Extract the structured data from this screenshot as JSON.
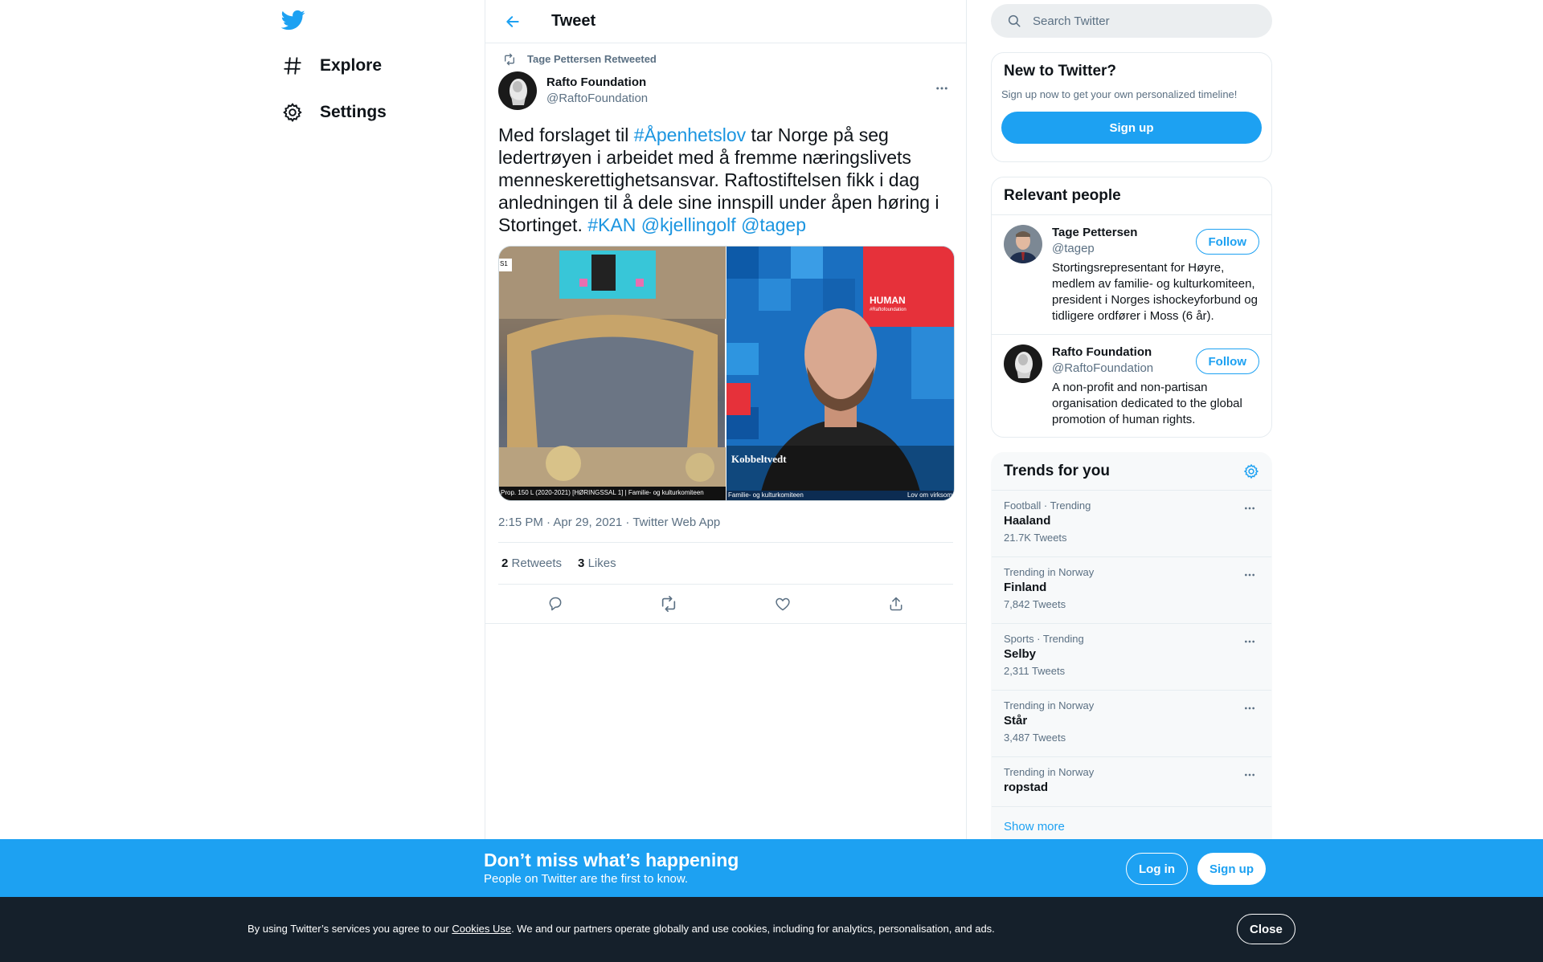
{
  "colors": {
    "brand": "#1da1f2",
    "link": "#1b95e0",
    "text": "#0f1419",
    "muted": "#5b7083"
  },
  "nav": {
    "logo_icon": "twitter-bird-icon",
    "items": [
      {
        "label": "Explore",
        "icon": "hashtag-icon"
      },
      {
        "label": "Settings",
        "icon": "gear-icon"
      }
    ]
  },
  "header": {
    "title": "Tweet",
    "back_icon": "arrow-left-icon"
  },
  "tweet": {
    "retweeted_by": "Tage Pettersen Retweeted",
    "author_name": "Rafto Foundation",
    "author_handle": "@RaftoFoundation",
    "text_parts": {
      "p1": "Med forslaget til ",
      "h1": "#Åpenhetslov",
      "p2": " tar Norge på seg ledertrøyen i arbeidet med å fremme næringslivets menneskerettighetsansvar. Raftostiftelsen fikk i dag anledningen til å dele sine innspill under åpen høring i Stortinget. ",
      "h2": "#KAN",
      "p3": " ",
      "m1": "@kjellingolf",
      "p4": " ",
      "m2": "@tagep"
    },
    "media": {
      "left_caption": "Prop. 150 L (2020-2021) [HØRINGSSAL 1] | Familie- og kulturkomiteen",
      "left_corner": "S1",
      "right_sign": "HUMAN",
      "right_sign_sub": "#Raftofoundation",
      "right_name": "Kobbeltvedt",
      "right_caption_left": "Familie- og kulturkomiteen",
      "right_caption_right": "Lov om virksom"
    },
    "meta": "2:15 PM · Apr 29, 2021 · Twitter Web App",
    "retweets_count": "2",
    "retweets_label": "Retweets",
    "likes_count": "3",
    "likes_label": "Likes"
  },
  "search": {
    "placeholder": "Search Twitter"
  },
  "new_card": {
    "title": "New to Twitter?",
    "desc": "Sign up now to get your own personalized timeline!",
    "signup": "Sign up"
  },
  "people": {
    "title": "Relevant people",
    "items": [
      {
        "name": "Tage Pettersen",
        "handle": "@tagep",
        "follow": "Follow",
        "bio": "Stortingsrepresentant for Høyre, medlem av familie- og kulturkomiteen, president i Norges ishockeyforbund og tidligere ordfører i Moss (6 år)."
      },
      {
        "name": "Rafto Foundation",
        "handle": "@RaftoFoundation",
        "follow": "Follow",
        "bio": "A non-profit and non-partisan organisation dedicated to the global promotion of human rights."
      }
    ]
  },
  "trends": {
    "title": "Trends for you",
    "items": [
      {
        "context": "Football · Trending",
        "name": "Haaland",
        "count": "21.7K Tweets"
      },
      {
        "context": "Trending in Norway",
        "name": "Finland",
        "count": "7,842 Tweets"
      },
      {
        "context": "Sports · Trending",
        "name": "Selby",
        "count": "2,311 Tweets"
      },
      {
        "context": "Trending in Norway",
        "name": "Står",
        "count": "3,487 Tweets"
      },
      {
        "context": "Trending in Norway",
        "name": "ropstad",
        "count": ""
      }
    ],
    "show_more": "Show more"
  },
  "banner": {
    "title": "Don’t miss what’s happening",
    "subtitle": "People on Twitter are the first to know.",
    "login": "Log in",
    "signup": "Sign up"
  },
  "cookie": {
    "prefix": "By using Twitter’s services you agree to our ",
    "link": "Cookies Use",
    "suffix": ". We and our partners operate globally and use cookies, including for analytics, personalisation, and ads.",
    "close": "Close"
  }
}
